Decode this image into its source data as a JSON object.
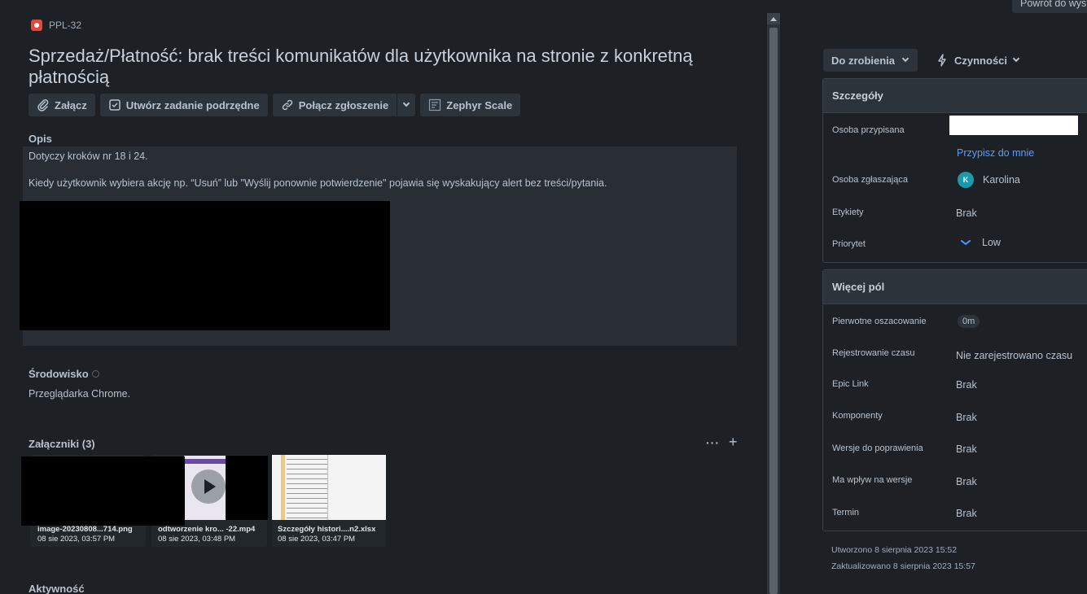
{
  "issue": {
    "key": "PPL-32",
    "title": "Sprzedaż/Płatność: brak treści komunikatów dla użytkownika na stronie z konkretną płatnością"
  },
  "toolbar": {
    "attach": "Załącz",
    "create_subtask": "Utwórz zadanie podrzędne",
    "link_issue": "Połącz zgłoszenie",
    "zephyr": "Zephyr Scale"
  },
  "description": {
    "heading": "Opis",
    "line1": "Dotyczy kroków nr 18 i 24.",
    "line2": "Kiedy użytkownik wybiera akcję np. “Usuń” lub \"Wyślij ponownie potwierdzenie\" pojawia się wyskakujący alert bez treści/pytania."
  },
  "environment": {
    "heading": "Środowisko",
    "value": "Przeglądarka Chrome."
  },
  "attachments": {
    "heading": "Załączniki (3)",
    "items": [
      {
        "name": "image-20230808...714.png",
        "date": "08 sie 2023, 03:57 PM"
      },
      {
        "name": "odtworzenie kro... -22.mp4",
        "date": "08 sie 2023, 03:48 PM"
      },
      {
        "name": "Szczegóły histori....n2.xlsx",
        "date": "08 sie 2023, 03:47 PM"
      }
    ]
  },
  "activity": {
    "heading": "Aktywność"
  },
  "back_button": "Powrót do wys",
  "status": {
    "label": "Do zrobienia"
  },
  "actions": {
    "label": "Czynności"
  },
  "details": {
    "heading": "Szczegóły",
    "assignee_label": "Osoba przypisana",
    "assign_to_me": "Przypisz do mnie",
    "reporter_label": "Osoba zgłaszająca",
    "reporter_initial": "K",
    "reporter_name": "Karolina",
    "labels_label": "Etykiety",
    "labels_value": "Brak",
    "priority_label": "Priorytet",
    "priority_value": "Low"
  },
  "more_fields": {
    "heading": "Więcej pól",
    "rows": [
      {
        "label": "Pierwotne oszacowanie",
        "value": "0m"
      },
      {
        "label": "Rejestrowanie czasu",
        "value": "Nie zarejestrowano czasu"
      },
      {
        "label": "Epic Link",
        "value": "Brak"
      },
      {
        "label": "Komponenty",
        "value": "Brak"
      },
      {
        "label": "Wersje do poprawienia",
        "value": "Brak"
      },
      {
        "label": "Ma wpływ na wersje",
        "value": "Brak"
      },
      {
        "label": "Termin",
        "value": "Brak"
      }
    ]
  },
  "meta": {
    "created": "Utworzono 8 sierpnia 2023 15:52",
    "updated": "Zaktualizowano 8 sierpnia 2023 15:57"
  },
  "colors": {
    "accent_link": "#579dff",
    "bug": "#e2483d",
    "priority_low": "#4c9aff"
  }
}
